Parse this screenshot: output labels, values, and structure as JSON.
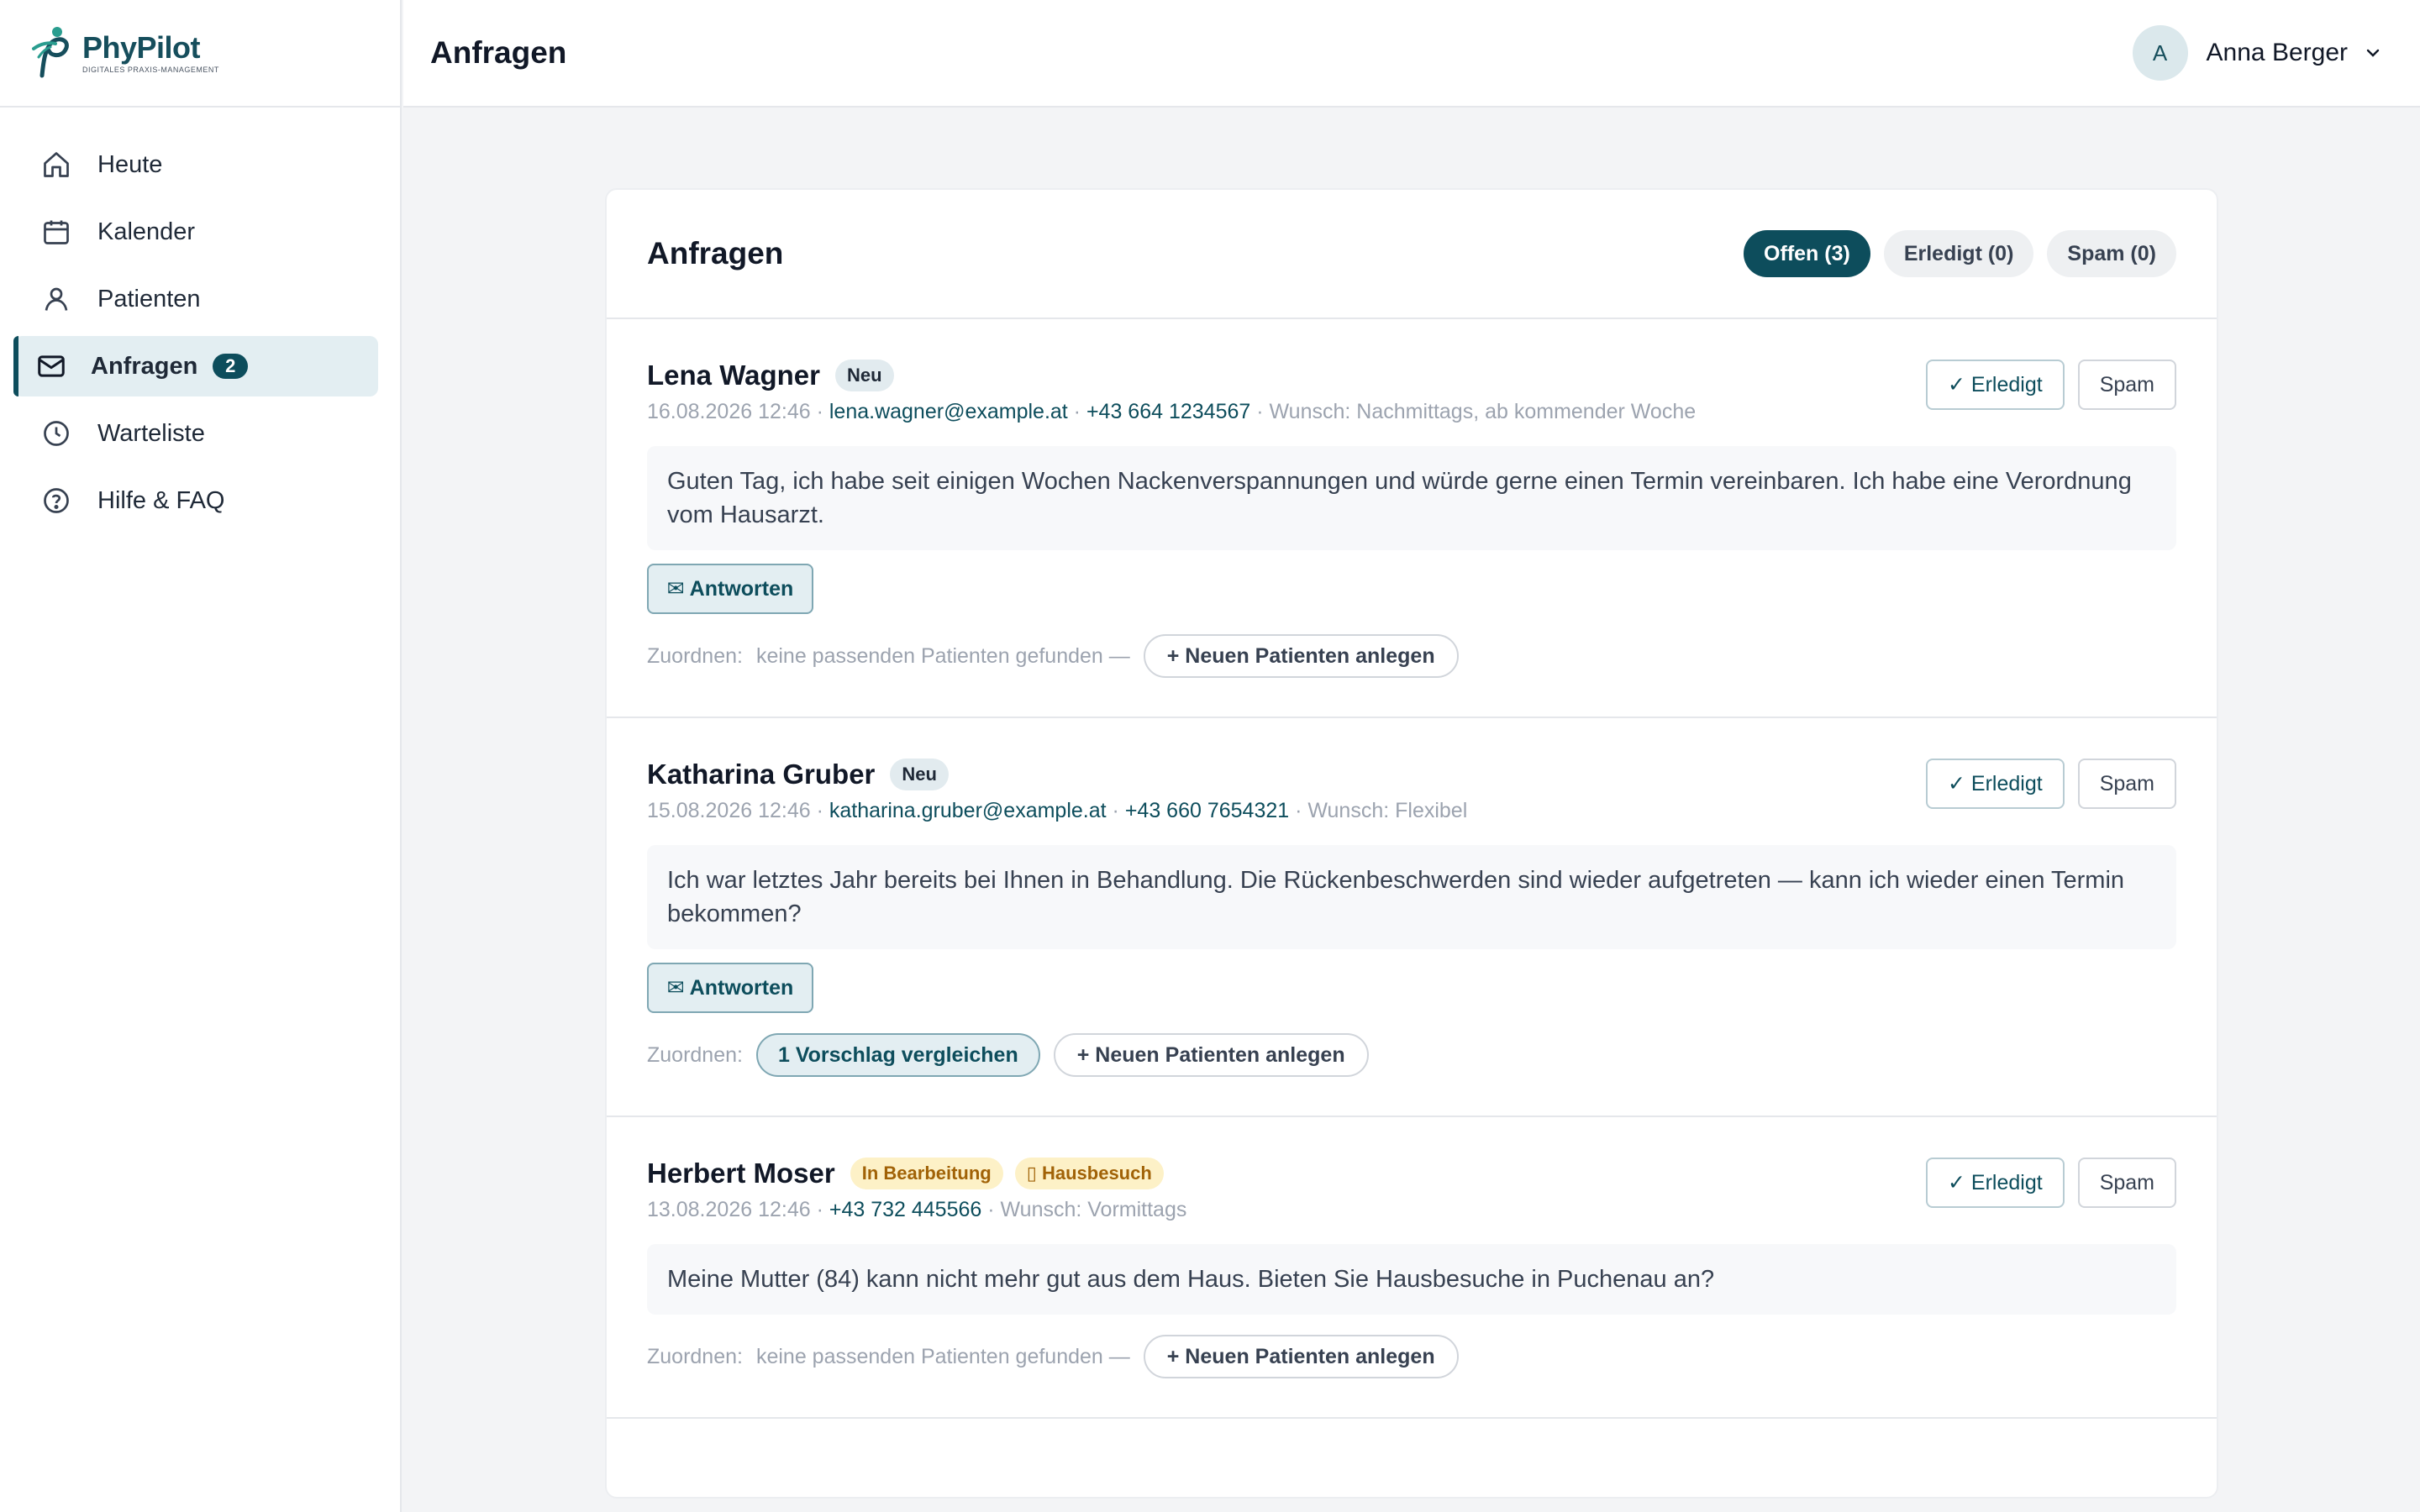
{
  "brand": {
    "name": "PhyPilot",
    "tagline": "DIGITALES PRAXIS-MANAGEMENT",
    "color": "#0d4d5c"
  },
  "sidebar": {
    "items": [
      {
        "label": "Heute",
        "icon": "home-icon"
      },
      {
        "label": "Kalender",
        "icon": "calendar-icon"
      },
      {
        "label": "Patienten",
        "icon": "person-icon"
      },
      {
        "label": "Anfragen",
        "icon": "mail-icon",
        "badge": "2",
        "active": true
      },
      {
        "label": "Warteliste",
        "icon": "clock-icon"
      },
      {
        "label": "Hilfe & FAQ",
        "icon": "help-icon"
      }
    ]
  },
  "header": {
    "title": "Anfragen",
    "user": {
      "initial": "A",
      "name": "Anna Berger"
    }
  },
  "card": {
    "title": "Anfragen",
    "filters": [
      "Offen (3)",
      "Erledigt (0)",
      "Spam (0)"
    ]
  },
  "actions": {
    "done": "✓ Erledigt",
    "spam": "Spam",
    "reply": "✉ Antworten",
    "assign_label": "Zuordnen:",
    "none_found": "keine passenden Patienten gefunden —",
    "new_patient": "+ Neuen Patienten anlegen"
  },
  "requests": [
    {
      "name": "Lena Wagner",
      "badge": "Neu",
      "date": "16.08.2026 12:46",
      "email": "lena.wagner@example.at",
      "phone": "+43 664 1234567",
      "wish": "Wunsch: Nachmittags, ab kommender Woche",
      "message": "Guten Tag, ich habe seit einigen Wochen Nackenverspannungen und würde gerne einen Termin vereinbaren. Ich habe eine Verordnung vom Hausarzt."
    },
    {
      "name": "Katharina Gruber",
      "badge": "Neu",
      "date": "15.08.2026 12:46",
      "email": "katharina.gruber@example.at",
      "phone": "+43 660 7654321",
      "wish": "Wunsch: Flexibel",
      "message": "Ich war letztes Jahr bereits bei Ihnen in Behandlung. Die Rückenbeschwerden sind wieder aufgetreten — kann ich wieder einen Termin bekommen?",
      "suggestion": "1 Vorschlag vergleichen"
    },
    {
      "name": "Herbert Moser",
      "badge": "In Bearbeitung",
      "badge2": "▯ Hausbesuch",
      "date": "13.08.2026 12:46",
      "phone": "+43 732 445566",
      "wish": "Wunsch: Vormittags",
      "message": "Meine Mutter (84) kann nicht mehr gut aus dem Haus. Bieten Sie Hausbesuche in Puchenau an?"
    }
  ]
}
